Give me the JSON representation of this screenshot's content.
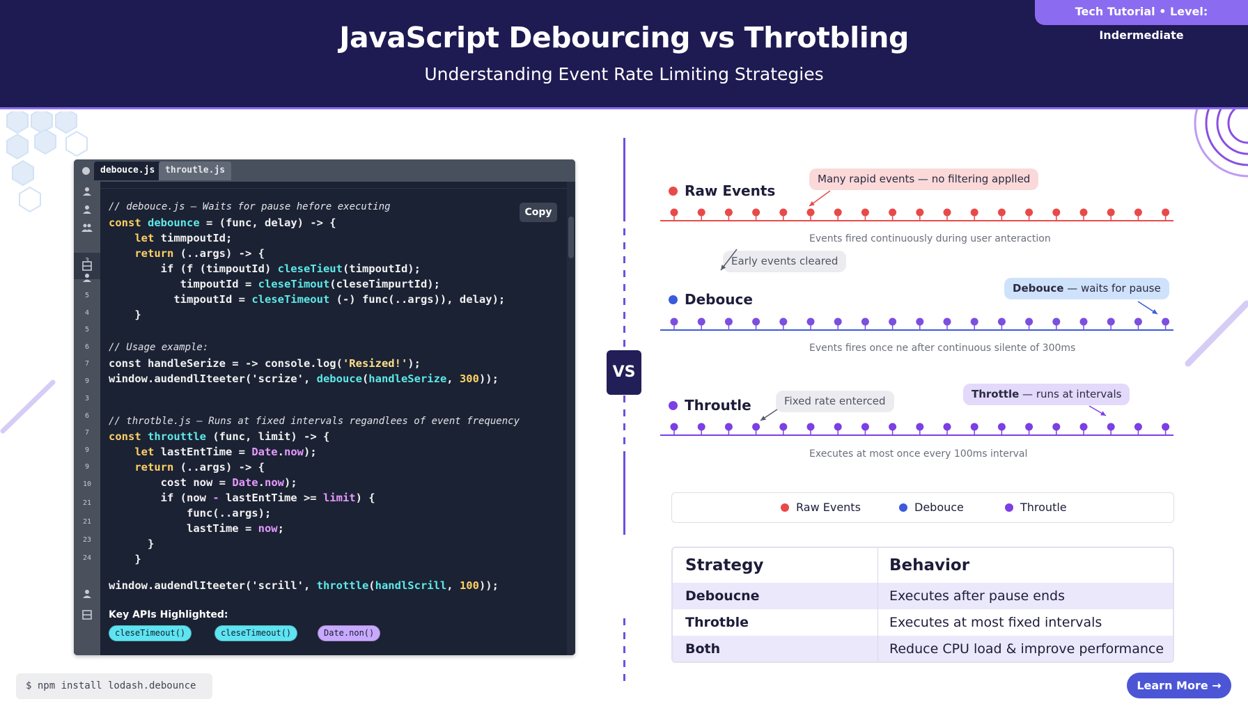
{
  "header": {
    "title": "JavaScript Debourcing vs Throtbling",
    "subtitle": "Understanding Event Rate Limiting Strategies",
    "badge": "Tech Tutorial • Level: Indermediate"
  },
  "editor": {
    "tabs": [
      "debouce.js",
      "throutle.js"
    ],
    "active_tab": "debouce.js",
    "copy_label": "Copy",
    "gutter_numbers": [
      "3",
      "5",
      "4",
      "5",
      "6",
      "7",
      "9",
      "3",
      "6",
      "7",
      "9",
      "9",
      "10",
      "21",
      "21",
      "23",
      "24"
    ],
    "apis_label": "Key APIs Highlighted:",
    "api_chips": [
      "cleseTimeout()",
      "cleseTimeout()",
      "Date.non()"
    ]
  },
  "code": {
    "l1": "// debouce.js — Waits for pause hefore executing",
    "l2": [
      "const",
      " ",
      "debounce",
      " = (func, delay) -> {"
    ],
    "l3": [
      "    let",
      " timmpoutId;"
    ],
    "l4": [
      "    return",
      " (..args) -> {"
    ],
    "l5": [
      "        if (f (timpoutId) ",
      "cleseTieut",
      "(timpoutId);"
    ],
    "l6": [
      "           timpoutId = ",
      "cleseTimout",
      "(cleseTimpurtId);"
    ],
    "l7": [
      "          timpoutId = ",
      "cleseTimeout",
      " (-) func(..args)), delay);"
    ],
    "l8": "    }",
    "l9": "// Usage example:",
    "l10": [
      "const handleSerize = -> console.log(",
      "'Resized!'",
      ");"
    ],
    "l11": [
      "window.audendlIteeter('scrize', ",
      "debouce",
      "(",
      "handleSerize",
      ", ",
      "300",
      "));"
    ],
    "l12": "// throtble.js — Runs at fixed intervals regandlees of event frequency",
    "l13": [
      "const",
      " ",
      "throuttle",
      " (func, limit) -> {"
    ],
    "l14": [
      "    let",
      " lastEntTime = ",
      "Date",
      ".",
      "now",
      ");"
    ],
    "l15": [
      "    return",
      " (..args) -> {"
    ],
    "l16": [
      "        cost now = ",
      "Date",
      ".",
      "now",
      ");"
    ],
    "l17": [
      "        if (now ",
      "-",
      " lastEntTime >= ",
      "limit",
      ") {"
    ],
    "l18": "            func(..args);",
    "l19": [
      "            lastTime = ",
      "now",
      ";"
    ],
    "l20": "      }",
    "l21": "    }",
    "l22": [
      "window.audendlIteeter('scrill', ",
      "throttle",
      "(",
      "handlScrill",
      ", ",
      "100",
      "));"
    ]
  },
  "npm_command": "$ npm install lodash.debounce",
  "vs_label": "VS",
  "timelines": {
    "raw": {
      "label": "Raw Events",
      "color": "#e84a4a",
      "callout": "Many rapid events — no filtering applled",
      "note": "Events fired continuously during user anteraction",
      "tag": "Early events cleared",
      "dot_count": 19
    },
    "debounce": {
      "label": "Debouce",
      "color": "#3b5bdb",
      "dot_color": "#7b4fe0",
      "callout_bold": "Debouce",
      "callout_rest": " — waits for pause",
      "note": "Events fires once ne after continuous silente of 300ms",
      "dot_count": 19
    },
    "throttle": {
      "label": "Throutle",
      "color": "#7b3fe4",
      "tag": "Fixed rate enterced",
      "callout_bold": "Throttle",
      "callout_rest": " — runs at intervals",
      "note": "Executes at most once every 100ms interval",
      "dot_count": 19
    }
  },
  "legend": [
    {
      "label": "Raw Events",
      "color": "#e84a4a"
    },
    {
      "label": "Debouce",
      "color": "#3b5bdb"
    },
    {
      "label": "Throutle",
      "color": "#7b3fe4"
    }
  ],
  "table": {
    "headers": [
      "Strategy",
      "Behavior"
    ],
    "rows": [
      [
        "Deboucne",
        "Executes after pause ends"
      ],
      [
        "Throtble",
        "Executes at most fixed intervals"
      ],
      [
        "Both",
        "Reduce CPU load & improve performance"
      ]
    ]
  },
  "learn_more": "Learn More →",
  "colors": {
    "header_bg": "#1e1a52",
    "accent": "#8b6cf0",
    "editor_bg": "#1b2233",
    "button": "#4b55d6"
  }
}
